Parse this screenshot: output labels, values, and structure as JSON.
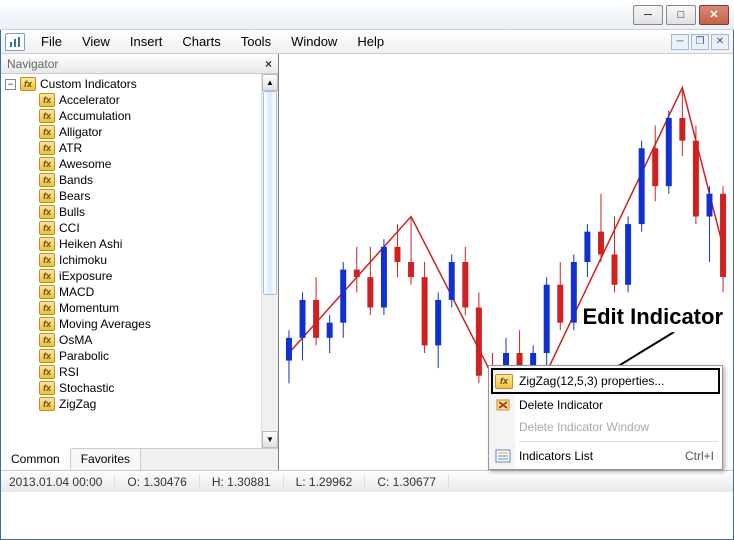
{
  "menu": {
    "file": "File",
    "view": "View",
    "insert": "Insert",
    "charts": "Charts",
    "tools": "Tools",
    "window": "Window",
    "help": "Help"
  },
  "navigator": {
    "title": "Navigator",
    "root": "Custom Indicators",
    "items": [
      "Accelerator",
      "Accumulation",
      "Alligator",
      "ATR",
      "Awesome",
      "Bands",
      "Bears",
      "Bulls",
      "CCI",
      "Heiken Ashi",
      "Ichimoku",
      "iExposure",
      "MACD",
      "Momentum",
      "Moving Averages",
      "OsMA",
      "Parabolic",
      "RSI",
      "Stochastic",
      "ZigZag"
    ],
    "tabs": {
      "common": "Common",
      "favorites": "Favorites"
    }
  },
  "context_menu": {
    "properties": "ZigZag(12,5,3) properties...",
    "delete_indicator": "Delete Indicator",
    "delete_window": "Delete Indicator Window",
    "indicators_list": "Indicators List",
    "shortcut": "Ctrl+I"
  },
  "annotation": "Edit Indicator",
  "status": {
    "date": "2013.01.04 00:00",
    "o_label": "O:",
    "o": "1.30476",
    "h_label": "H:",
    "h": "1.30881",
    "l_label": "L:",
    "l": "1.29962",
    "c_label": "C:",
    "c": "1.30677"
  },
  "chart_data": {
    "type": "candlestick-with-zigzag",
    "note": "approximate OHLC candles read from screenshot pixels; y-axis range ~1.295 to ~1.320",
    "zigzag_points": [
      {
        "x": 0,
        "y": 1.302
      },
      {
        "x": 9,
        "y": 1.311
      },
      {
        "x": 17,
        "y": 1.297
      },
      {
        "x": 29,
        "y": 1.3195
      },
      {
        "x": 32,
        "y": 1.309
      }
    ],
    "candles": [
      {
        "o": 1.3015,
        "h": 1.3035,
        "l": 1.3,
        "c": 1.303
      },
      {
        "o": 1.303,
        "h": 1.306,
        "l": 1.3015,
        "c": 1.3055
      },
      {
        "o": 1.3055,
        "h": 1.307,
        "l": 1.3025,
        "c": 1.303
      },
      {
        "o": 1.303,
        "h": 1.3045,
        "l": 1.302,
        "c": 1.304
      },
      {
        "o": 1.304,
        "h": 1.308,
        "l": 1.303,
        "c": 1.3075
      },
      {
        "o": 1.3075,
        "h": 1.309,
        "l": 1.306,
        "c": 1.307
      },
      {
        "o": 1.307,
        "h": 1.309,
        "l": 1.3045,
        "c": 1.305
      },
      {
        "o": 1.305,
        "h": 1.3095,
        "l": 1.3045,
        "c": 1.309
      },
      {
        "o": 1.309,
        "h": 1.3105,
        "l": 1.307,
        "c": 1.308
      },
      {
        "o": 1.308,
        "h": 1.311,
        "l": 1.3065,
        "c": 1.307
      },
      {
        "o": 1.307,
        "h": 1.308,
        "l": 1.302,
        "c": 1.3025
      },
      {
        "o": 1.3025,
        "h": 1.306,
        "l": 1.301,
        "c": 1.3055
      },
      {
        "o": 1.3055,
        "h": 1.3085,
        "l": 1.305,
        "c": 1.308
      },
      {
        "o": 1.308,
        "h": 1.309,
        "l": 1.3045,
        "c": 1.305
      },
      {
        "o": 1.305,
        "h": 1.306,
        "l": 1.3,
        "c": 1.3005
      },
      {
        "o": 1.3005,
        "h": 1.302,
        "l": 1.298,
        "c": 1.2995
      },
      {
        "o": 1.2995,
        "h": 1.303,
        "l": 1.298,
        "c": 1.302
      },
      {
        "o": 1.302,
        "h": 1.3035,
        "l": 1.297,
        "c": 1.298
      },
      {
        "o": 1.298,
        "h": 1.3025,
        "l": 1.2975,
        "c": 1.302
      },
      {
        "o": 1.302,
        "h": 1.307,
        "l": 1.301,
        "c": 1.3065
      },
      {
        "o": 1.3065,
        "h": 1.308,
        "l": 1.3035,
        "c": 1.304
      },
      {
        "o": 1.304,
        "h": 1.3085,
        "l": 1.3035,
        "c": 1.308
      },
      {
        "o": 1.308,
        "h": 1.3105,
        "l": 1.307,
        "c": 1.31
      },
      {
        "o": 1.31,
        "h": 1.3125,
        "l": 1.308,
        "c": 1.3085
      },
      {
        "o": 1.3085,
        "h": 1.311,
        "l": 1.306,
        "c": 1.3065
      },
      {
        "o": 1.3065,
        "h": 1.311,
        "l": 1.306,
        "c": 1.3105
      },
      {
        "o": 1.3105,
        "h": 1.316,
        "l": 1.31,
        "c": 1.3155
      },
      {
        "o": 1.3155,
        "h": 1.317,
        "l": 1.312,
        "c": 1.313
      },
      {
        "o": 1.313,
        "h": 1.318,
        "l": 1.3125,
        "c": 1.3175
      },
      {
        "o": 1.3175,
        "h": 1.3195,
        "l": 1.315,
        "c": 1.316
      },
      {
        "o": 1.316,
        "h": 1.317,
        "l": 1.3105,
        "c": 1.311
      },
      {
        "o": 1.311,
        "h": 1.313,
        "l": 1.308,
        "c": 1.3125
      },
      {
        "o": 1.3125,
        "h": 1.313,
        "l": 1.306,
        "c": 1.307
      }
    ]
  }
}
